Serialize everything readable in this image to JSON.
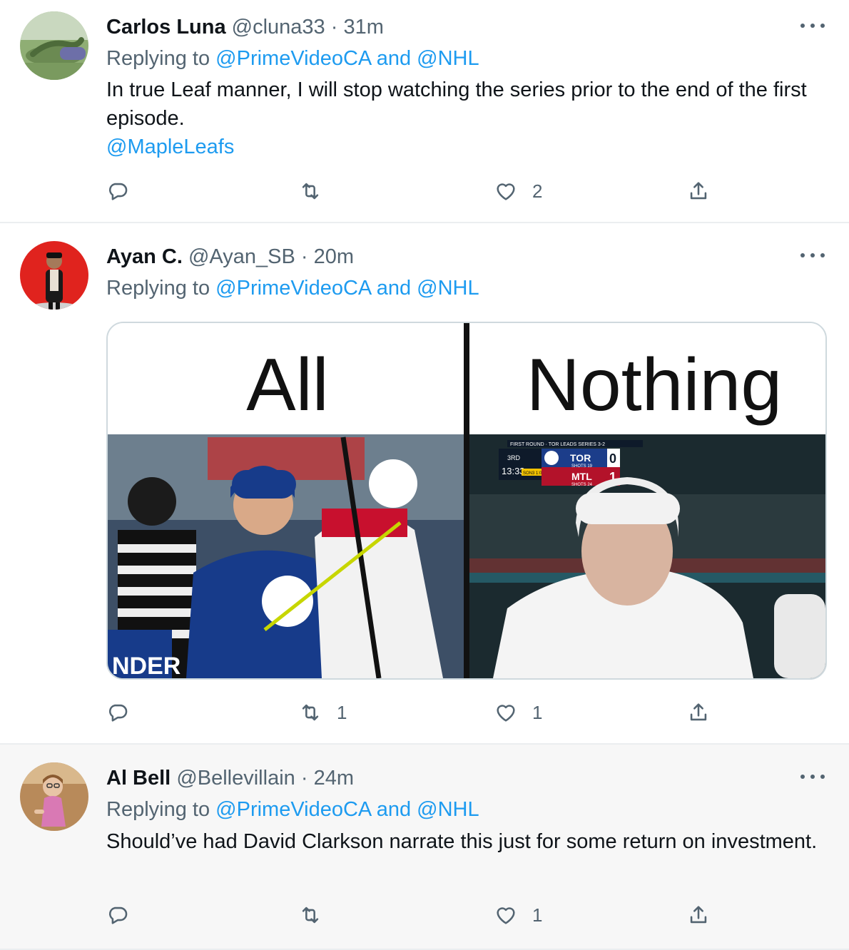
{
  "tweets": [
    {
      "name": "Carlos Luna",
      "handle": "@cluna33",
      "sep": "·",
      "time": "31m",
      "replying_prefix": "Replying to ",
      "replying_to_1": "@PrimeVideoCA",
      "replying_and": " and ",
      "replying_to_2": "@NHL",
      "text": "In true Leaf manner, I will stop watching the series prior to the end of the first episode.",
      "mention": "@MapleLeafs",
      "retweets": "",
      "likes": "2"
    },
    {
      "name": "Ayan C.",
      "handle": "@Ayan_SB",
      "sep": "·",
      "time": "20m",
      "replying_prefix": "Replying to ",
      "replying_to_1": "@PrimeVideoCA",
      "replying_and": " and ",
      "replying_to_2": "@NHL",
      "media": {
        "left_caption": "All",
        "right_caption": "Nothing",
        "scoreboard": {
          "round": "FIRST ROUND · TOR LEADS SERIES 3-2",
          "period": "3RD",
          "clock": "13:33",
          "team1": "TOR",
          "score1": "0",
          "shots1": "SHOTS 19",
          "team2": "MTL",
          "score2": "1",
          "shots2": "SHOTS 24",
          "pp": "SON3 1:00"
        },
        "jersey_text": "NDER"
      },
      "retweets": "1",
      "likes": "1"
    },
    {
      "name": "Al Bell",
      "handle": "@Bellevillain",
      "sep": "·",
      "time": "24m",
      "replying_prefix": "Replying to ",
      "replying_to_1": "@PrimeVideoCA",
      "replying_and": " and ",
      "replying_to_2": "@NHL",
      "text": "Should’ve had David Clarkson narrate this just for some return on investment.",
      "retweets": "",
      "likes": "1"
    }
  ],
  "colors": {
    "link": "#1d9bf0",
    "secondary_text": "#536471",
    "highlight_bg": "#f7f7f7"
  },
  "icons": [
    "reply-icon",
    "retweet-icon",
    "like-icon",
    "share-icon",
    "more-icon"
  ]
}
